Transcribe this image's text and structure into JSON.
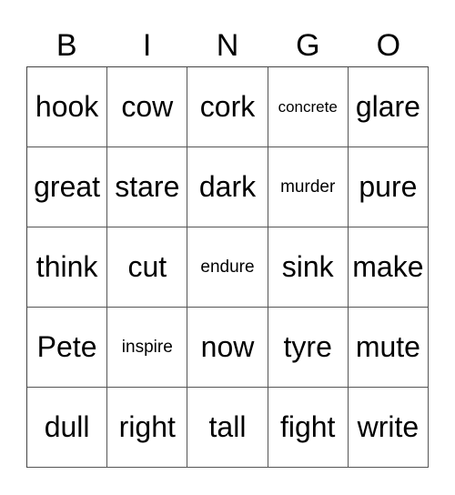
{
  "header": [
    "B",
    "I",
    "N",
    "G",
    "O"
  ],
  "rows": [
    [
      "hook",
      "cow",
      "cork",
      "concrete",
      "glare"
    ],
    [
      "great",
      "stare",
      "dark",
      "murder",
      "pure"
    ],
    [
      "think",
      "cut",
      "endure",
      "sink",
      "make"
    ],
    [
      "Pete",
      "inspire",
      "now",
      "tyre",
      "mute"
    ],
    [
      "dull",
      "right",
      "tall",
      "fight",
      "write"
    ]
  ]
}
